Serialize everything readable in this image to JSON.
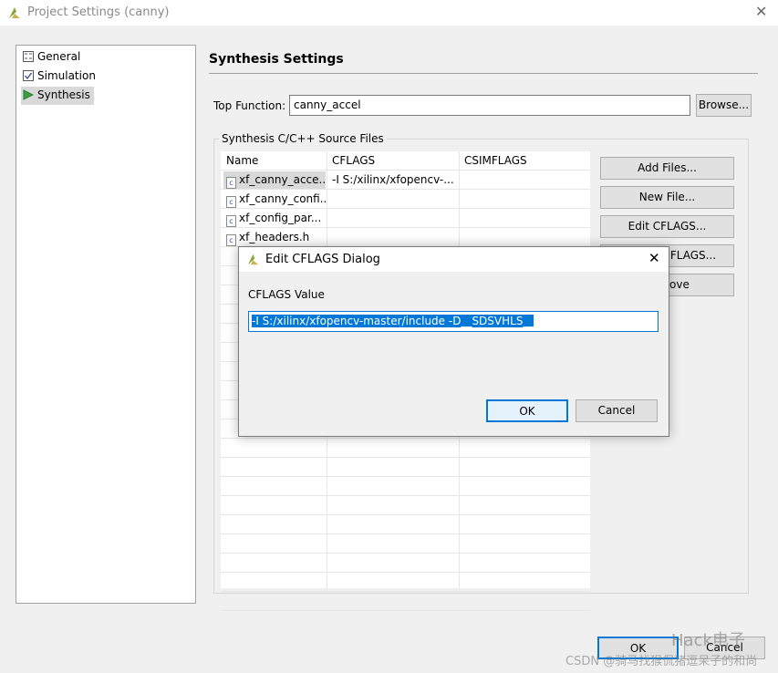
{
  "window": {
    "title": "Project Settings (canny)",
    "close_icon": "close-icon"
  },
  "nav": {
    "items": [
      {
        "label": "General",
        "icon": "settings-list-icon"
      },
      {
        "label": "Simulation",
        "icon": "checkbox-icon"
      },
      {
        "label": "Synthesis",
        "icon": "play-triangle-icon",
        "selected": true
      }
    ]
  },
  "main": {
    "heading": "Synthesis Settings",
    "top_function_label": "Top Function:",
    "top_function_value": "canny_accel",
    "browse_label": "Browse...",
    "group_label": "Synthesis C/C++ Source Files",
    "table": {
      "columns": [
        "Name",
        "CFLAGS",
        "CSIMFLAGS"
      ],
      "rows": [
        {
          "name": "xf_canny_acce...",
          "cflags": "-I S:/xilinx/xfopencv-...",
          "csimflags": ""
        },
        {
          "name": "xf_canny_confi...",
          "cflags": "",
          "csimflags": ""
        },
        {
          "name": "xf_config_par...",
          "cflags": "",
          "csimflags": ""
        },
        {
          "name": "xf_headers.h",
          "cflags": "",
          "csimflags": ""
        }
      ]
    },
    "buttons": [
      "Add Files...",
      "New File...",
      "Edit CFLAGS...",
      "Edit CSIMFLAGS...",
      "Remove"
    ]
  },
  "footer": {
    "ok": "OK",
    "cancel": "Cancel"
  },
  "dialog": {
    "title": "Edit CFLAGS Dialog",
    "field_label": "CFLAGS Value",
    "field_value": "-I S:/xilinx/xfopencv-master/include -D__SDSVHLS__",
    "ok": "OK",
    "cancel": "Cancel"
  },
  "watermark": {
    "brand": "Hack电子",
    "credit": "CSDN @骑马找猴侃猪逗呆子的和尚"
  },
  "colors": {
    "accent": "#0078d7",
    "selection": "#0078d7"
  }
}
